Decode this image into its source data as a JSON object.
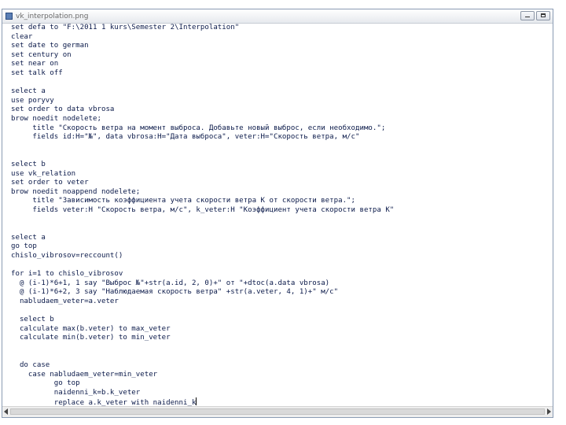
{
  "window": {
    "title": "vk_interpolation.png"
  },
  "colors": {
    "code_text": "#0b1a4a",
    "keyword": "#1b2f8c",
    "window_border": "#8a9bb3"
  },
  "icons": {
    "app": "document-icon",
    "minimize": "minimize-icon",
    "maximize": "maximize-icon",
    "scroll_left": "arrow-left-icon",
    "scroll_right": "arrow-right-icon"
  },
  "code_lines": [
    "set defa to \"F:\\2011 1 kurs\\Semester 2\\Interpolation\"",
    "clear",
    "set date to german",
    "set century on",
    "set near on",
    "set talk off",
    "",
    "select a",
    "use poryvy",
    "set order to data vbrosa",
    "brow noedit nodelete;",
    "     title \"Скорость ветра на момент выброса. Добавьте новый выброс, если необходимо.\";",
    "     fields id:H=\"№\", data vbrosa:H=\"Дата выброса\", veter:H=\"Скорость ветра, м/с\"",
    "",
    "",
    "select b",
    "use vk_relation",
    "set order to veter",
    "brow noedit noappend nodelete;",
    "     title \"Зависимость коэффициента учета скорости ветра K от скорости ветра.\";",
    "     fields veter:H \"Скорость ветра, м/с\", k_veter:H \"Коэффициент учета скорости ветра K\"",
    "",
    "",
    "select a",
    "go top",
    "chislo_vibrosov=reccount()",
    "",
    "for i=1 to chislo_vibrosov",
    "  @ (i-1)*6+1, 1 say \"Выброс №\"+str(a.id, 2, 0)+\" от \"+dtoc(a.data vbrosa)",
    "  @ (i-1)*6+2, 3 say \"Наблюдаемая скорость ветра\" +str(a.veter, 4, 1)+\" м/с\"",
    "  nabludaem_veter=a.veter",
    "",
    "  select b",
    "  calculate max(b.veter) to max_veter",
    "  calculate min(b.veter) to min_veter",
    "",
    "",
    "  do case",
    "    case nabludaem_veter=min_veter",
    "          go top",
    "          naidenni_k=b.k_veter",
    "          replace a.k_veter with naidenni_k"
  ]
}
